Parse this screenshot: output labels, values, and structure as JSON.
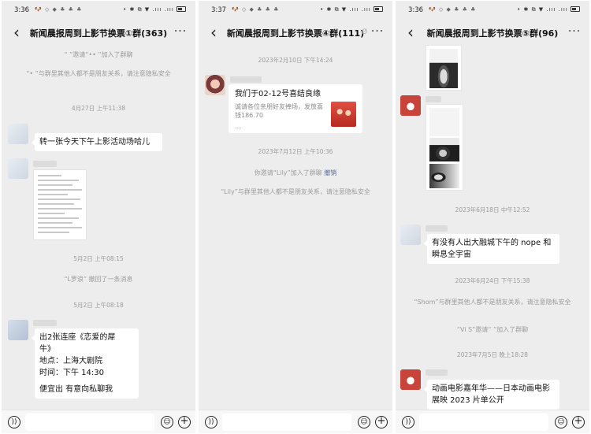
{
  "status_bars": [
    {
      "time": "3:36",
      "notif": "🐶 ◇ ◆ ♣ ♣ ♣",
      "right": "• ✱ ⧉ ▼ .ııı .ııı"
    },
    {
      "time": "3:37",
      "notif": "🐶 ◇ ◆ ♣ ♣ ♣",
      "right": "• ✱ ⧉ ▼ .ııı .ııı"
    },
    {
      "time": "3:36",
      "notif": "🐶 ◇ ◆ ♣ ♣ ♣",
      "right": "• ✱ ⧉ ▼ .ııı .ııı"
    }
  ],
  "nav": {
    "back": "‹",
    "more": "···",
    "mute": "Ø"
  },
  "chats": [
    {
      "title": "新闻晨报周到上影节换票①群(363)",
      "sys1": "“     ”邀请“•• ”加入了群聊",
      "sys2": "“• ”与群里其他人都不是朋友关系，请注意隐私安全",
      "ts1": "4月27日 上午11:38",
      "msg1": "转一张今天下午上影活动场哈儿",
      "ts2": "5月2日 上午08:15",
      "sys3": "“L罗浪” 撤回了一条消息",
      "ts3": "5月2日 上午08:18",
      "msg2": {
        "line1": "出2张连座《恋爱的犀",
        "line2": "牛》",
        "line3": "地点：上海大剧院",
        "line4": "时间：下午 14:30",
        "line5": "便宜出 有意向私聊我"
      }
    },
    {
      "title": "新闻晨报周到上影节换票④群(111)",
      "ts1": "2023年2月10日 下午14:24",
      "card_title": "我们于02-12号喜结良缘",
      "card_desc": "诚请各位亲朋好友捧场，发放喜钱186.70",
      "card_more": "...",
      "ts2": "2023年7月12日 上午10:36",
      "sys1_pre": "你邀请“Lily”加入了群聊  ",
      "sys1_link": "撤销",
      "sys2": "“Lily”与群里其他人都不是朋友关系，请注意隐私安全"
    },
    {
      "title": "新闻晨报周到上影节换票⑤群(96)",
      "ts1": "2023年6月18日 中午12:52",
      "msg1": "有没有人出大融城下午的 nope 和瞬息全宇宙",
      "ts2": "2023年6月24日 下午15:38",
      "sys1": "“Shom”与群里其他人都不是朋友关系，请注意隐私安全",
      "sys2": "“Vi   S”邀请“      ”加入了群聊",
      "ts3": "2023年7月5日 晚上18:28",
      "msg2": "动画电影嘉年华——日本动画电影展映 2023 片单公开"
    }
  ],
  "inputbar": {
    "voice": "))",
    "emoji": "☺",
    "plus": "+"
  }
}
